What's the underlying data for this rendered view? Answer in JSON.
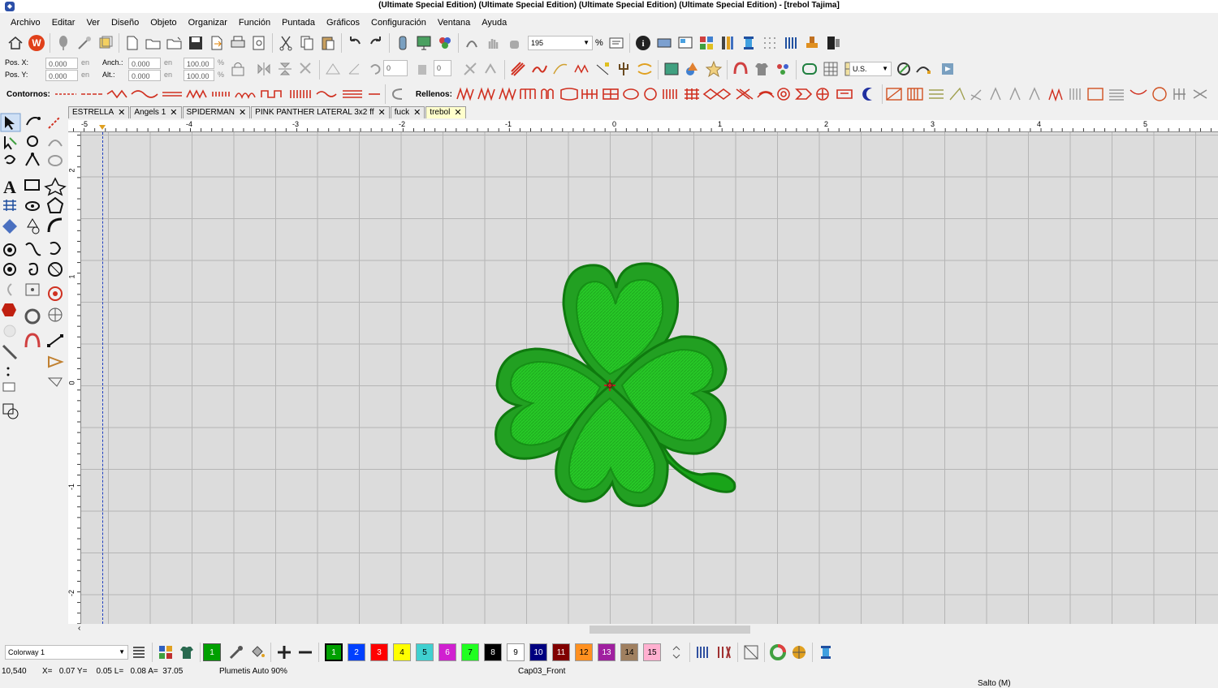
{
  "window": {
    "title": "(Ultimate Special Edition) (Ultimate Special Edition) (Ultimate Special Edition) (Ultimate Special Edition) - [trebol        Tajima]"
  },
  "menu": [
    "Archivo",
    "Editar",
    "Ver",
    "Diseño",
    "Objeto",
    "Organizar",
    "Función",
    "Puntada",
    "Gráficos",
    "Configuración",
    "Ventana",
    "Ayuda"
  ],
  "toolbar": {
    "zoom_value": "195",
    "zoom_unit": "%",
    "units_value": "U.S."
  },
  "props": {
    "posx_label": "Pos. X:",
    "posx_value": "0.000",
    "posx_unit": "en",
    "posy_label": "Pos. Y:",
    "posy_value": "0.000",
    "posy_unit": "en",
    "width_label": "Anch.:",
    "width_value": "0.000",
    "width_unit": "en",
    "height_label": "Alt.:",
    "height_value": "0.000",
    "height_unit": "en",
    "scalex": "100.00",
    "scaley": "100.00",
    "pct": "%",
    "angle_value": "0",
    "slant_value": "0"
  },
  "stitch_bar": {
    "contours_label": "Contornos:",
    "fills_label": "Rellenos:"
  },
  "tabs": [
    {
      "label": "ESTRELLA"
    },
    {
      "label": "Angels 1"
    },
    {
      "label": "SPIDERMAN"
    },
    {
      "label": "PINK PANTHER LATERAL  3x2 ff"
    },
    {
      "label": "fuck"
    },
    {
      "label": "trebol"
    }
  ],
  "ruler": {
    "h_labels": [
      "-5",
      "-4",
      "-3",
      "-2",
      "-1",
      "0",
      "1",
      "2",
      "3",
      "4",
      "5"
    ],
    "v_labels": [
      "2",
      "1",
      "0",
      "-1",
      "-2"
    ]
  },
  "colorway": {
    "value": "Colorway 1",
    "current_color_index": "1"
  },
  "palette": [
    {
      "num": "1",
      "color": "#00a000",
      "text": "#fff"
    },
    {
      "num": "2",
      "color": "#0040ff",
      "text": "#fff"
    },
    {
      "num": "3",
      "color": "#ff0000",
      "text": "#fff"
    },
    {
      "num": "4",
      "color": "#ffff00",
      "text": "#000"
    },
    {
      "num": "5",
      "color": "#40d0d0",
      "text": "#000"
    },
    {
      "num": "6",
      "color": "#d020d0",
      "text": "#fff"
    },
    {
      "num": "7",
      "color": "#20ff20",
      "text": "#000"
    },
    {
      "num": "8",
      "color": "#000000",
      "text": "#fff"
    },
    {
      "num": "9",
      "color": "#ffffff",
      "text": "#000"
    },
    {
      "num": "10",
      "color": "#000080",
      "text": "#fff"
    },
    {
      "num": "11",
      "color": "#800000",
      "text": "#fff"
    },
    {
      "num": "12",
      "color": "#ff9020",
      "text": "#000"
    },
    {
      "num": "13",
      "color": "#a020a0",
      "text": "#fff"
    },
    {
      "num": "14",
      "color": "#a08060",
      "text": "#000"
    },
    {
      "num": "15",
      "color": "#ffb0d0",
      "text": "#000"
    }
  ],
  "status": {
    "stitches": "10,540",
    "coords": "X=   0.07 Y=    0.05 L=   0.08 A=  37.05",
    "fill_type": "Plumetis Auto 90%",
    "hoop": "Cap03_Front",
    "mode": "Salto (M)"
  },
  "design": {
    "primary_color": "#1fbf1f",
    "outline_color": "#138a13"
  }
}
